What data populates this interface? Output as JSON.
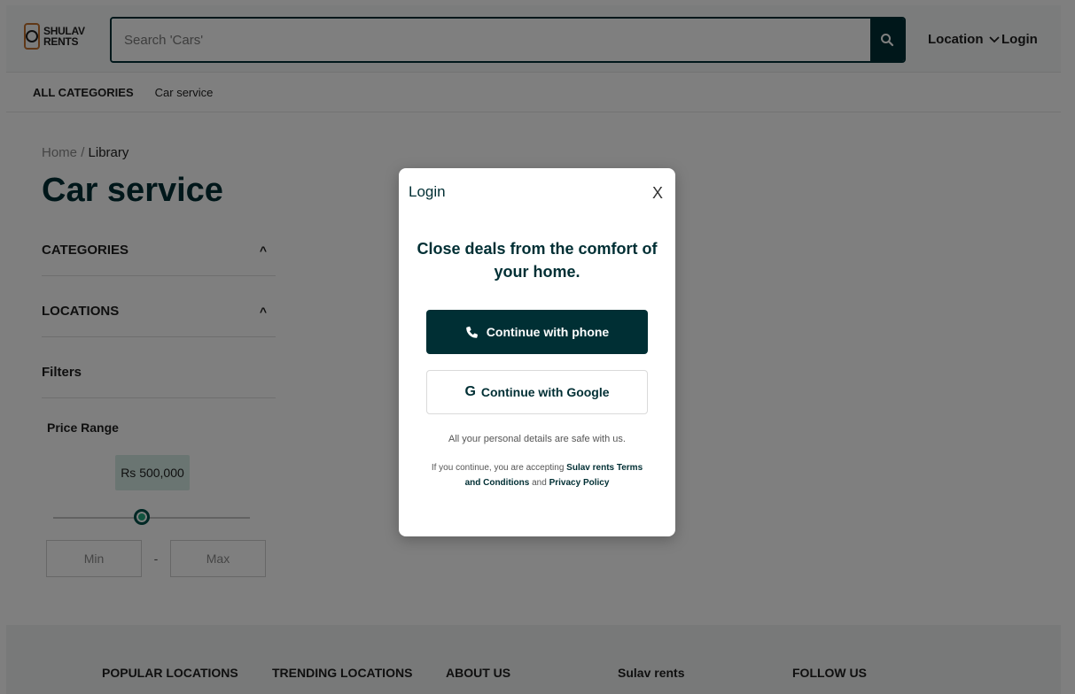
{
  "brand": {
    "line1": "SHULAV",
    "line2": "RENTS"
  },
  "header": {
    "search_placeholder": "Search 'Cars'",
    "location_label": "Location",
    "login_label": "Login"
  },
  "catbar": {
    "all_label": "ALL CATEGORIES",
    "item": "Car service"
  },
  "breadcrumb": {
    "home": "Home",
    "sep": "/",
    "current": "Library"
  },
  "page_title": "Car service",
  "sidebar": {
    "categories": "CATEGORIES",
    "locations": "LOCATIONS",
    "filters": "Filters",
    "caret": "^",
    "price_label": "Price Range",
    "price_value": "Rs 500,000",
    "price_fraction": 0.45,
    "min_label": "Min",
    "max_label": "Max",
    "dash": "-"
  },
  "footer": {
    "cols": [
      "POPULAR LOCATIONS",
      "TRENDING LOCATIONS",
      "ABOUT US",
      "Sulav rents",
      "FOLLOW US"
    ]
  },
  "modal": {
    "title": "Login",
    "close": "X",
    "heading": "Close deals from the comfort of your home.",
    "phone_btn": "Continue with phone",
    "google_btn": "Continue with Google",
    "safe_note": "All your personal details are safe with us.",
    "legal_prefix": "If you continue, you are accepting",
    "legal_terms": "Sulav rents Terms and Conditions",
    "legal_and": "and",
    "legal_privacy": "Privacy Policy"
  },
  "colors": {
    "brand_dark": "#002f34",
    "accent": "#23a97f",
    "badge_bg": "#d4ebe5",
    "logo_orange": "#c0712f"
  }
}
